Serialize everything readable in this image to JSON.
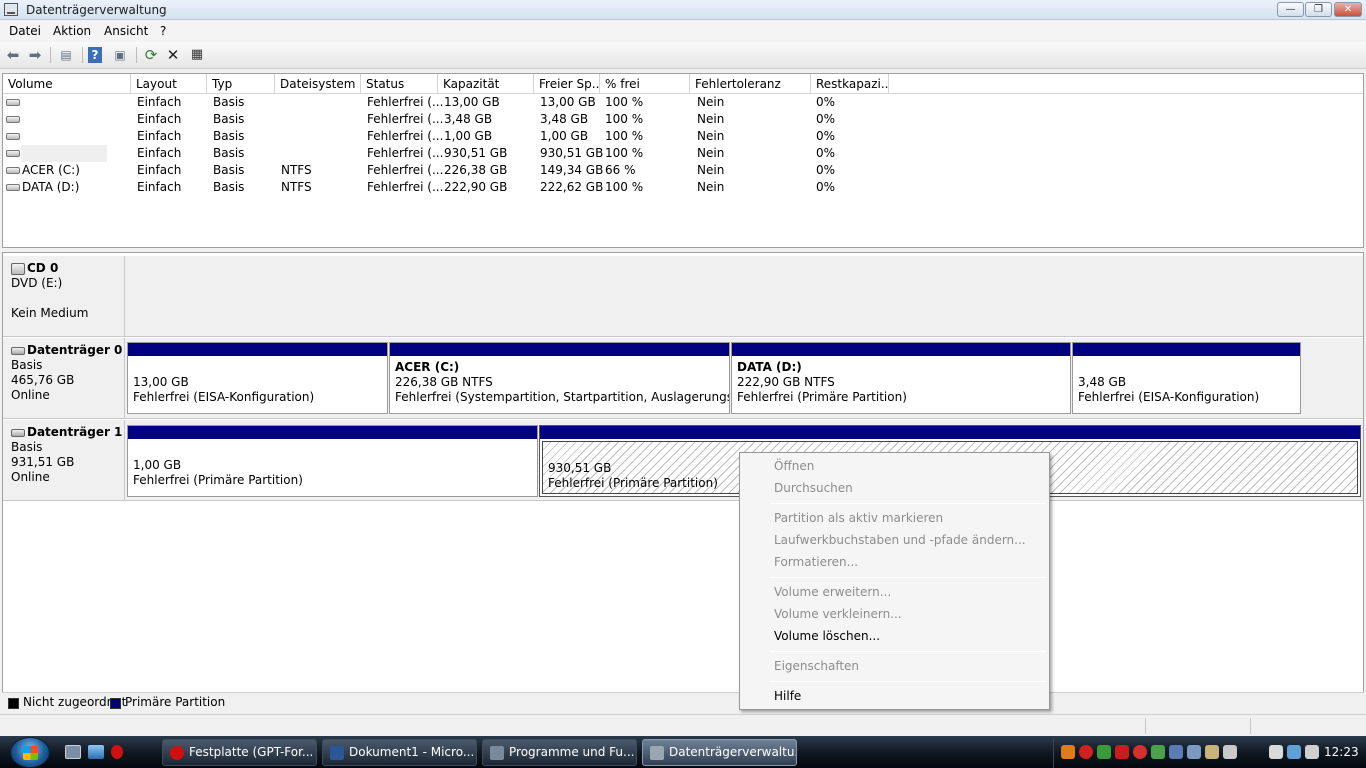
{
  "window": {
    "title": "Datenträgerverwaltung"
  },
  "menu": [
    {
      "label": "Datei"
    },
    {
      "label": "Aktion"
    },
    {
      "label": "Ansicht"
    },
    {
      "label": "?"
    }
  ],
  "volume_list": {
    "columns": [
      "Volume",
      "Layout",
      "Typ",
      "Dateisystem",
      "Status",
      "Kapazität",
      "Freier Sp...",
      "% frei",
      "Fehlertoleranz",
      "Restkapazi..."
    ],
    "rows": [
      {
        "volume": "",
        "layout": "Einfach",
        "typ": "Basis",
        "dateisystem": "",
        "status": "Fehlerfrei (...",
        "kapazitaet": "13,00 GB",
        "frei": "13,00 GB",
        "prozent": "100 %",
        "fehlertoleranz": "Nein",
        "rest": "0%"
      },
      {
        "volume": "",
        "layout": "Einfach",
        "typ": "Basis",
        "dateisystem": "",
        "status": "Fehlerfrei (...",
        "kapazitaet": "3,48 GB",
        "frei": "3,48 GB",
        "prozent": "100 %",
        "fehlertoleranz": "Nein",
        "rest": "0%"
      },
      {
        "volume": "",
        "layout": "Einfach",
        "typ": "Basis",
        "dateisystem": "",
        "status": "Fehlerfrei (...",
        "kapazitaet": "1,00 GB",
        "frei": "1,00 GB",
        "prozent": "100 %",
        "fehlertoleranz": "Nein",
        "rest": "0%"
      },
      {
        "volume": "",
        "layout": "Einfach",
        "typ": "Basis",
        "dateisystem": "",
        "status": "Fehlerfrei (...",
        "kapazitaet": "930,51 GB",
        "frei": "930,51 GB",
        "prozent": "100 %",
        "fehlertoleranz": "Nein",
        "rest": "0%"
      },
      {
        "volume": "ACER (C:)",
        "layout": "Einfach",
        "typ": "Basis",
        "dateisystem": "NTFS",
        "status": "Fehlerfrei (...",
        "kapazitaet": "226,38 GB",
        "frei": "149,34 GB",
        "prozent": "66 %",
        "fehlertoleranz": "Nein",
        "rest": "0%"
      },
      {
        "volume": "DATA (D:)",
        "layout": "Einfach",
        "typ": "Basis",
        "dateisystem": "NTFS",
        "status": "Fehlerfrei (...",
        "kapazitaet": "222,90 GB",
        "frei": "222,62 GB",
        "prozent": "100 %",
        "fehlertoleranz": "Nein",
        "rest": "0%"
      }
    ]
  },
  "disks": {
    "cd0": {
      "name": "CD 0",
      "line1": "DVD (E:)",
      "line2": "Kein Medium"
    },
    "disk0": {
      "name": "Datenträger 0",
      "type": "Basis",
      "size": "465,76 GB",
      "state": "Online",
      "partitions": [
        {
          "title": "",
          "size": "13,00 GB",
          "status": "Fehlerfrei (EISA-Konfiguration)"
        },
        {
          "title": "ACER  (C:)",
          "size": "226,38 GB NTFS",
          "status": "Fehlerfrei (Systempartition, Startpartition, Auslagerungsdatei, Ab"
        },
        {
          "title": "DATA  (D:)",
          "size": "222,90 GB NTFS",
          "status": "Fehlerfrei (Primäre Partition)"
        },
        {
          "title": "",
          "size": "3,48 GB",
          "status": "Fehlerfrei (EISA-Konfiguration)"
        }
      ]
    },
    "disk1": {
      "name": "Datenträger 1",
      "type": "Basis",
      "size": "931,51 GB",
      "state": "Online",
      "partitions": [
        {
          "size": "1,00 GB",
          "status": "Fehlerfrei (Primäre Partition)"
        },
        {
          "size": "930,51 GB",
          "status": "Fehlerfrei (Primäre Partition)"
        }
      ]
    }
  },
  "legend": [
    {
      "label": "Nicht zugeordnet",
      "color": "#000000"
    },
    {
      "label": "Primäre Partition",
      "color": "#000080"
    }
  ],
  "context_menu": [
    {
      "label": "Öffnen",
      "enabled": false
    },
    {
      "label": "Durchsuchen",
      "enabled": false
    },
    {
      "label": "Partition als aktiv markieren",
      "enabled": false
    },
    {
      "label": "Laufwerkbuchstaben und -pfade ändern...",
      "enabled": false
    },
    {
      "label": "Formatieren...",
      "enabled": false
    },
    {
      "label": "Volume erweitern...",
      "enabled": false
    },
    {
      "label": "Volume verkleinern...",
      "enabled": false
    },
    {
      "label": "Volume löschen...",
      "enabled": true
    },
    {
      "label": "Eigenschaften",
      "enabled": false
    },
    {
      "label": "Hilfe",
      "enabled": true
    }
  ],
  "taskbar": {
    "tasks": [
      {
        "label": "Festplatte (GPT-For...",
        "icon": "opera-icon",
        "color": "#d01010"
      },
      {
        "label": "Dokument1 - Micro...",
        "icon": "word-icon",
        "color": "#2b5797"
      },
      {
        "label": "Programme und Fu...",
        "icon": "control-panel-icon",
        "color": "#7a8a9a"
      },
      {
        "label": "Datenträgerverwaltu...",
        "icon": "disk-management-icon",
        "color": "#9aa6b2"
      }
    ],
    "clock": "12:23"
  }
}
